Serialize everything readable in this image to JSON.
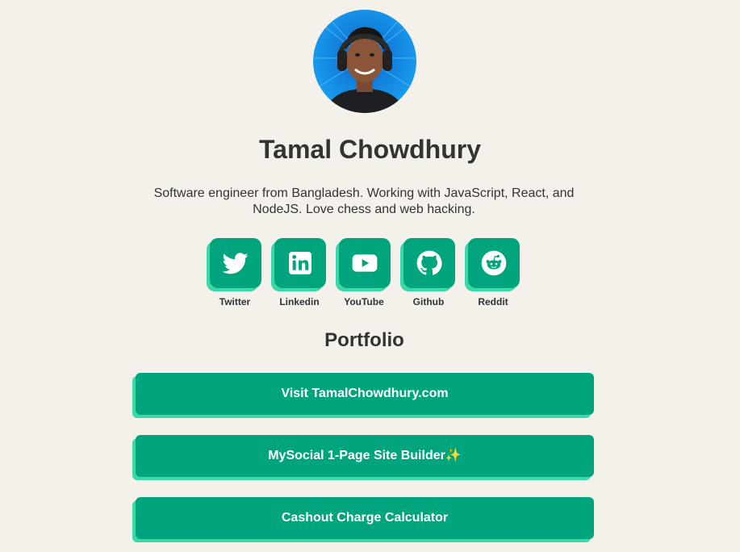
{
  "profile": {
    "name": "Tamal Chowdhury",
    "bio": "Software engineer from Bangladesh. Working with JavaScript, React, and NodeJS. Love chess and web hacking."
  },
  "socials": [
    {
      "label": "Twitter",
      "icon": "twitter-icon"
    },
    {
      "label": "Linkedin",
      "icon": "linkedin-icon"
    },
    {
      "label": "YouTube",
      "icon": "youtube-icon"
    },
    {
      "label": "Github",
      "icon": "github-icon"
    },
    {
      "label": "Reddit",
      "icon": "reddit-icon"
    }
  ],
  "portfolio": {
    "title": "Portfolio",
    "links": [
      {
        "label": "Visit TamalChowdhury.com"
      },
      {
        "label": "MySocial 1-Page Site Builder✨"
      },
      {
        "label": "Cashout Charge Calculator"
      }
    ]
  },
  "colors": {
    "background": "#f4f1ea",
    "accent": "#00a57e",
    "accent_shadow": "#3dd8a8",
    "text": "#333333"
  }
}
